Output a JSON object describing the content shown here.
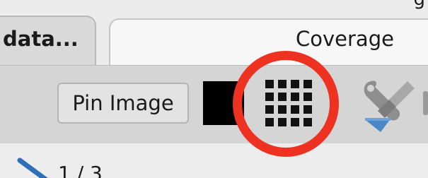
{
  "tabs": [
    {
      "label": "data...",
      "active": true
    },
    {
      "label": "Coverage",
      "active": false
    }
  ],
  "toolbar": {
    "pin_image_label": "Pin Image",
    "icons": [
      "black-color-swatch",
      "grid-icon",
      "tools-icon"
    ]
  },
  "content": {
    "page_indicator": "1 / 3"
  },
  "colors": {
    "highlight_ring": "#ee3222",
    "toolbar_bg": "#d5d5d5",
    "tools_blue": "#4a87c7"
  }
}
